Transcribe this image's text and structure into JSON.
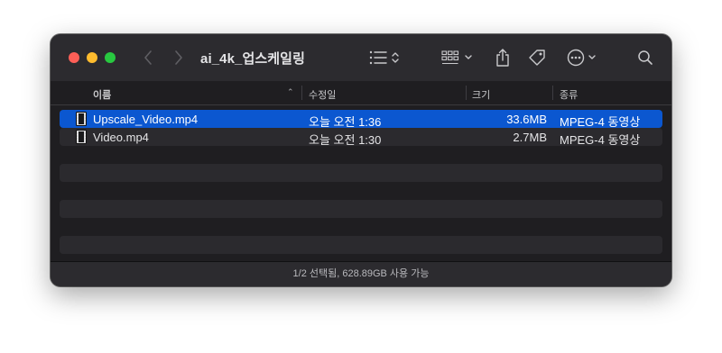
{
  "window": {
    "title": "ai_4k_업스케일링"
  },
  "toolbar": {
    "back_icon": "chevron-left-icon",
    "forward_icon": "chevron-right-icon",
    "view_icon": "list-view-icon",
    "group_icon": "grid-group-icon",
    "share_icon": "share-icon",
    "tag_icon": "tag-icon",
    "action_icon": "ellipsis-circle-icon",
    "search_icon": "search-icon"
  },
  "columns": {
    "name": "이름",
    "date": "수정일",
    "size": "크기",
    "kind": "종류"
  },
  "files": [
    {
      "name": "Upscale_Video.mp4",
      "date": "오늘 오전 1:36",
      "size": "33.6MB",
      "kind": "MPEG-4 동영상",
      "selected": true
    },
    {
      "name": "Video.mp4",
      "date": "오늘 오전 1:30",
      "size": "2.7MB",
      "kind": "MPEG-4 동영상",
      "selected": false
    }
  ],
  "status": {
    "text": "1/2 선택됨, 628.89GB 사용 가능"
  },
  "colors": {
    "selection": "#0b57d0",
    "window_bg": "#1f1e21",
    "toolbar_bg": "#2c2b2f"
  }
}
